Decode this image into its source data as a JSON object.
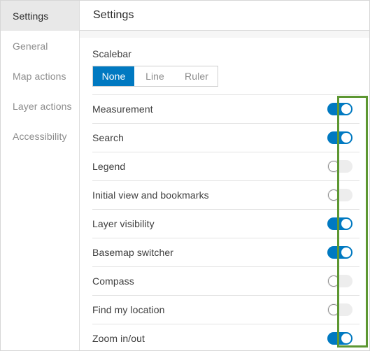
{
  "sidebar": {
    "items": [
      {
        "label": "Settings",
        "active": true
      },
      {
        "label": "General",
        "active": false
      },
      {
        "label": "Map actions",
        "active": false
      },
      {
        "label": "Layer actions",
        "active": false
      },
      {
        "label": "Accessibility",
        "active": false
      }
    ]
  },
  "header": {
    "title": "Settings"
  },
  "content": {
    "scalebar_label": "Scalebar",
    "scalebar_options": [
      "None",
      "Line",
      "Ruler"
    ],
    "scalebar_selected": "None",
    "rows": [
      {
        "label": "Measurement",
        "state": "on"
      },
      {
        "label": "Search",
        "state": "on"
      },
      {
        "label": "Legend",
        "state": "off"
      },
      {
        "label": "Initial view and bookmarks",
        "state": "off"
      },
      {
        "label": "Layer visibility",
        "state": "on"
      },
      {
        "label": "Basemap switcher",
        "state": "on"
      },
      {
        "label": "Compass",
        "state": "off"
      },
      {
        "label": "Find my location",
        "state": "off"
      },
      {
        "label": "Zoom in/out",
        "state": "on"
      }
    ]
  },
  "colors": {
    "accent_blue": "#0079c1",
    "highlight_green": "#5d9732",
    "toggle_off_track": "#ededed",
    "sidebar_active_bg": "#e8e8e8",
    "text_primary": "#3d3d3d",
    "text_muted": "#8c8c8c",
    "divider": "#e3e3e3"
  },
  "annotation": {
    "highlight_name": "toggle-column-highlight"
  }
}
